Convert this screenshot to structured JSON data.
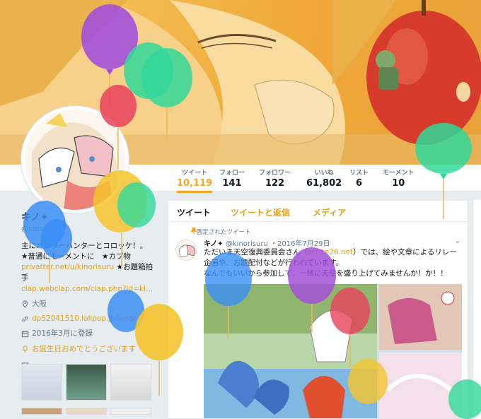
{
  "nav": {
    "stats": [
      {
        "label": "ツイート",
        "value": "10,119"
      },
      {
        "label": "フォロー",
        "value": "141"
      },
      {
        "label": "フォロワー",
        "value": "122"
      },
      {
        "label": "いいね",
        "value": "61,802"
      },
      {
        "label": "リスト",
        "value": "6"
      },
      {
        "label": "モーメント",
        "value": "10"
      }
    ]
  },
  "profile": {
    "name": "キノ✦",
    "handle": "@kinorisuru",
    "bio_line1": "主にハンターハンターとコロッケ！。",
    "bio_line2": "★普通にモーメントに　★カプ物",
    "link1": "privatter.net/u/kinorisuru",
    "bio_line3": "★お題箱拍手",
    "link2": "clap.webclap.com/clap.php?id=ki...",
    "location": "大阪",
    "website": "dp52041510.lolipop.jp/kino/",
    "joined": "2016年3月に登録",
    "birthday": "お誕生日おめでとうございます"
  },
  "timeline": {
    "tabs": [
      "ツイート",
      "ツイートと返信",
      "メディア"
    ],
    "pinned_label": "固定されたツイート",
    "tweet": {
      "name": "キノ✦",
      "handle": "@kinorisuru",
      "date": "・2016年7月29日",
      "text_pre": "ただいま天空復興委員会さん（",
      "text_link": "arc.te26.net",
      "text_post": "）では、絵や文章によるリレー企画や、お題配付などが行われています。",
      "text_line3": "なんでもいいから参加して、一緒に天空を盛り上げてみませんか！か！！"
    }
  },
  "icons": {
    "location": "location-pin-icon",
    "link": "link-icon",
    "calendar": "calendar-icon",
    "birthday": "balloon-icon",
    "media": "photo-icon",
    "pin": "pin-icon",
    "chevron": "chevron-down-icon"
  },
  "colors": {
    "accent": "#f5a623",
    "link": "#e3a21a"
  }
}
